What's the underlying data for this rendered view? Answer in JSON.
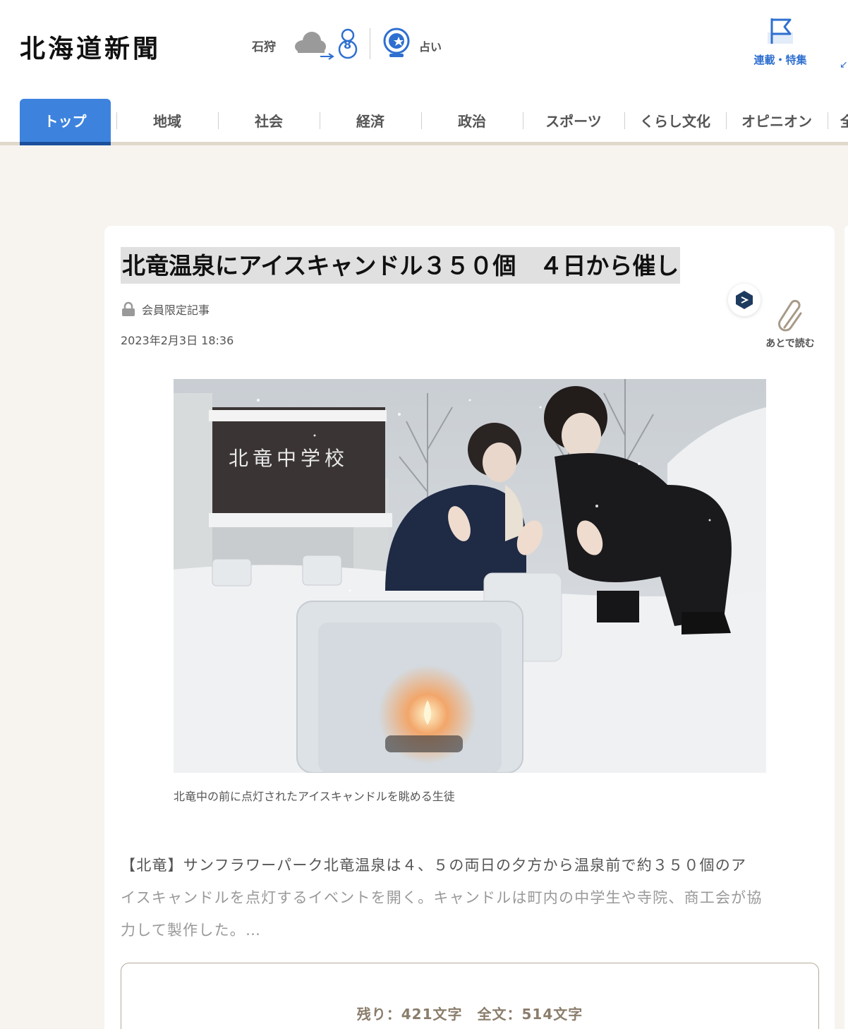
{
  "header": {
    "logo": "北海道新聞",
    "weather": {
      "region": "石狩",
      "temperature": "8",
      "icon": "cloud-to-snowman-icon"
    },
    "fortune_label": "占い",
    "series_label": "連載・特集"
  },
  "nav": {
    "items": [
      {
        "label": "トップ",
        "active": true
      },
      {
        "label": "地域"
      },
      {
        "label": "社会"
      },
      {
        "label": "経済"
      },
      {
        "label": "政治"
      },
      {
        "label": "スポーツ"
      },
      {
        "label": "くらし文化"
      },
      {
        "label": "オピニオン"
      },
      {
        "label": "全"
      }
    ]
  },
  "article": {
    "headline": "北竜温泉にアイスキャンドル３５０個　４日から催し",
    "members_only": "会員限定記事",
    "date": "2023年2月3日 18:36",
    "read_later": "あとで読む",
    "photo": {
      "sign_text": "北竜中学校",
      "caption": "北竜中の前に点灯されたアイスキャンドルを眺める生徒"
    },
    "body_line1": "【北竜】サンフラワーパーク北竜温泉は４、５の両日の夕方から温泉前で約３５０個のア",
    "body_line2": "イスキャンドルを点灯するイベントを開く。キャンドルは町内の中学生や寺院、商工会が協",
    "body_line3": "力して製作した。…",
    "remaining": "残り：421文字　全文：514文字"
  },
  "colors": {
    "accent": "#3d83de",
    "link": "#2e6fd0",
    "page_bg": "#f7f4f0",
    "paywall_text": "#8a7d6b"
  }
}
